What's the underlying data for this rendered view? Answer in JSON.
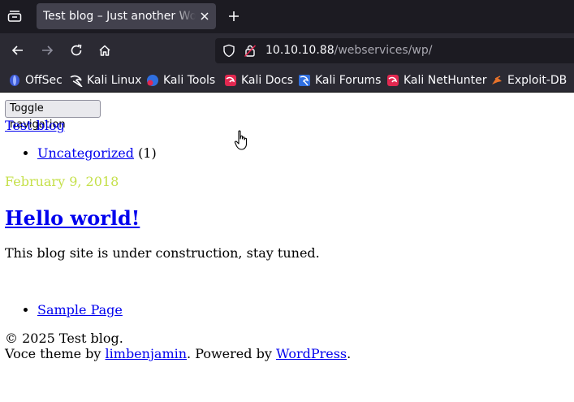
{
  "browser": {
    "tab": {
      "title": "Test blog – Just another WordPress site"
    },
    "url": {
      "host": "10.10.10.88",
      "path": "/webservices/wp/"
    },
    "bookmarks": [
      {
        "label": "OffSec",
        "icon": "offsec-icon"
      },
      {
        "label": "Kali Linux",
        "icon": "kali-dragon-icon"
      },
      {
        "label": "Kali Tools",
        "icon": "kali-tools-icon"
      },
      {
        "label": "Kali Docs",
        "icon": "kali-docs-icon"
      },
      {
        "label": "Kali Forums",
        "icon": "kali-forums-icon"
      },
      {
        "label": "Kali NetHunter",
        "icon": "kali-nethunter-icon"
      },
      {
        "label": "Exploit-DB",
        "icon": "exploit-db-icon"
      }
    ]
  },
  "page": {
    "toggle_label": "Toggle navigation",
    "site_title": "Test blog",
    "categories": [
      {
        "name": "Uncategorized",
        "count": "(1)"
      }
    ],
    "post": {
      "date": "February 9, 2018",
      "title": "Hello world!",
      "body": "This blog site is under construction, stay tuned."
    },
    "footer_links": [
      "Sample Page"
    ],
    "copyright": "© 2025 Test blog.",
    "credits": {
      "prefix": "Voce theme by ",
      "author": "limbenjamin",
      "middle": ". Powered by ",
      "platform": "WordPress",
      "suffix": "."
    }
  },
  "colors": {
    "tab_bar_bg": "#1c1b22",
    "toolbar_bg": "#2b2a33",
    "link": "#0000ee",
    "date": "#c5e04a"
  }
}
